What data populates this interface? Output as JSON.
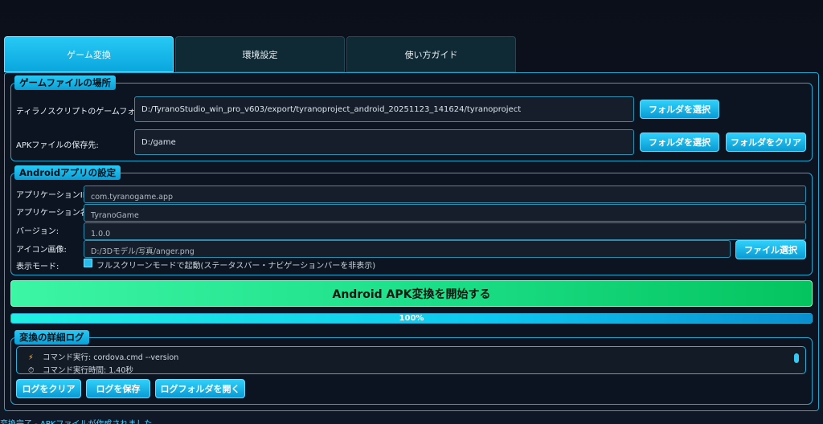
{
  "tabs": [
    {
      "label": "ゲーム変換",
      "active": true
    },
    {
      "label": "環境設定",
      "active": false
    },
    {
      "label": "使い方ガイド",
      "active": false
    }
  ],
  "game_files": {
    "legend": "ゲームファイルの場所",
    "folder_label": "ティラノスクリプトのゲームフォルダ:",
    "folder_value": "D:/TyranoStudio_win_pro_v603/export/tyranoproject_android_20251123_141624/tyranoproject",
    "folder_button": "フォルダを選択",
    "apk_label": "APKファイルの保存先:",
    "apk_value": "D:/game",
    "apk_select_button": "フォルダを選択",
    "apk_clear_button": "フォルダをクリア"
  },
  "android": {
    "legend": "Androidアプリの設定",
    "app_id_label": "アプリケーションID:",
    "app_id_value": "com.tyranogame.app",
    "app_name_label": "アプリケーション名:",
    "app_name_value": "TyranoGame",
    "version_label": "バージョン:",
    "version_value": "1.0.0",
    "icon_label": "アイコン画像:",
    "icon_value": "D:/3Dモデル/写真/anger.png",
    "icon_button": "ファイル選択",
    "display_label": "表示モード:",
    "fullscreen_label": "フルスクリーンモードで起動(ステータスバー・ナビゲーションバーを非表示)",
    "fullscreen_checked": true
  },
  "start_button": "Android APK変換を開始する",
  "progress": {
    "value": 100,
    "text": "100%"
  },
  "log": {
    "legend": "変換の詳細ログ",
    "lines": [
      {
        "icon": "⚡",
        "text": "コマンド実行: cordova.cmd --version"
      },
      {
        "icon": "⏱",
        "text": "コマンド実行時間: 1.40秒"
      }
    ],
    "clear_button": "ログをクリア",
    "save_button": "ログを保存",
    "open_button": "ログフォルダを開く"
  },
  "status": "変換完了 - APKファイルが作成されました"
}
